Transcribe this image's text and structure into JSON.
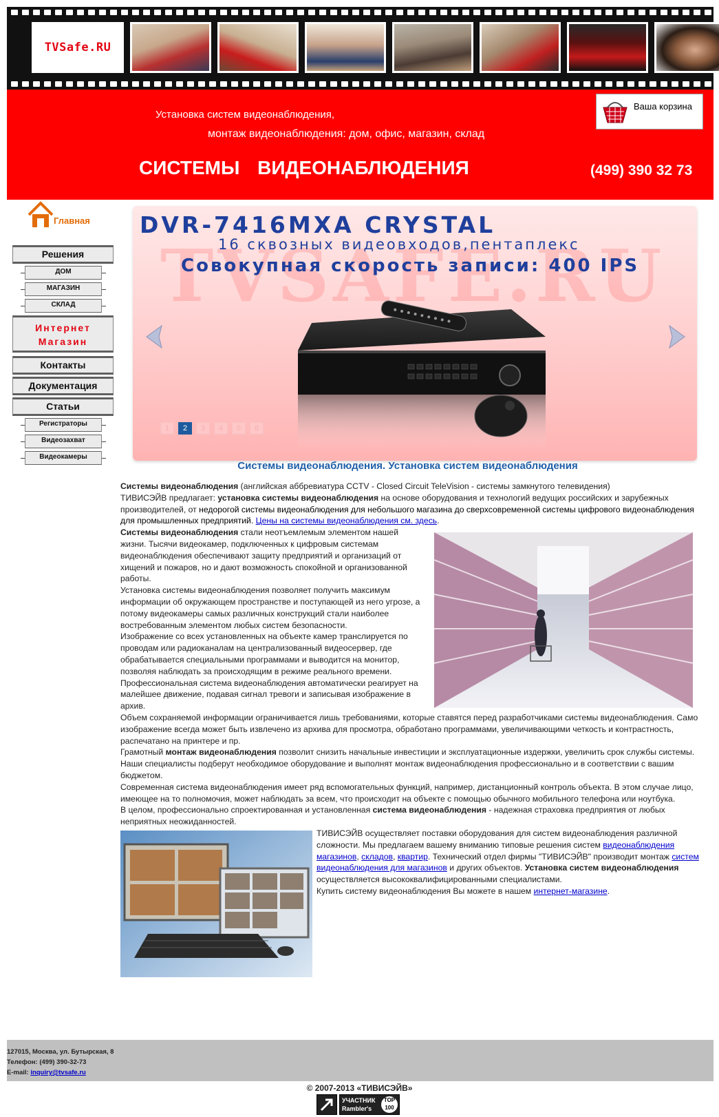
{
  "header": {
    "logo_text": "TVSafe.RU",
    "photo_count": 7
  },
  "banner": {
    "line1": "Установка систем видеонаблюдения,",
    "line2": "монтаж видеонаблюдения: дом, офис, магазин, склад",
    "title": "СИСТЕМЫ ВИДЕОНАБЛЮДЕНИЯ",
    "phone": "(499) 390 32 73",
    "cart_label": "Ваша корзина",
    "bg_color": "#ff0000"
  },
  "nav": {
    "home_label": "Главная",
    "solutions": "Решения",
    "home_item": "ДОМ",
    "shop_item": "МАГАЗИН",
    "warehouse_item": "СКЛАД",
    "online_shop_line1": "Интернет",
    "online_shop_line2": "Магазин",
    "contacts": "Контакты",
    "docs": "Документация",
    "articles": "Статьи",
    "recorders": "Регистраторы",
    "capture": "Видеозахват",
    "cameras": "Видеокамеры"
  },
  "slider": {
    "watermark": "TVSAFE.RU",
    "title": "DVR-7416MXA CRYSTAL",
    "subtitle": "16 сквозных видеовходов,пентаплекс",
    "speed": "Совокупная скорость записи: 400 IPS",
    "pages": [
      "1",
      "2",
      "3",
      "4",
      "5",
      "6"
    ],
    "active_page": "2"
  },
  "main": {
    "heading": "Системы видеонаблюдения. Установка систем видеонаблюдения",
    "p1_bold": "Системы видеонаблюдения",
    "p1_rest": " (английская аббревиатура CCTV - Closed Circuit TeleVision - системы замкнутого телевидения)",
    "p2_a": "ТИВИСЭЙВ предлагает: ",
    "p2_bold": "установка системы видеонаблюдения",
    "p2_b": "  на основе оборудования и технологий ведущих российских и зарубежных производителей, от ",
    "p2_dark": "недорогой системы видеонаблюдения для небольшого магазина до сверхсовременной системы цифрового видеонаблюдения для промышленных предприятий",
    "p2_c": ". ",
    "p2_link": "Цены на системы видеонаблюдения см. здесь",
    "p2_d": ".",
    "p3_bold": "Системы видеонаблюдения",
    "p3_rest": " стали неотъемлемым элементом нашей жизни. Тысячи видеокамер, подключенных к цифровым системам видеонаблюдения обеспечивают защиту предприятий и организаций от хищений и пожаров, но и дают возможность спокойной и организованной работы.",
    "p4": "Установка системы видеонаблюдения позволяет получить максимум информации об окружающем пространстве и поступающей из него угрозе, а потому видеокамеры самых различных конструкций стали наиболее востребованным элементом любых систем безопасности.",
    "p5": "Изображение со всех установленных на объекте камер транслируется по проводам или радиоканалам на централизованный видеосервер, где обрабатывается специальными программами и выводится на монитор, позволяя наблюдать за происходящим в режиме реального времени.",
    "p6": "Профессиональная система видеонаблюдения автоматически реагирует на малейшее движение, подавая сигнал тревоги и записывая изображение в архив.",
    "p7": "Объем сохраняемой информации ограничивается лишь требованиями, которые ставятся перед разработчиками системы видеонаблюдения. Само изображение всегда может быть извлечено из архива для просмотра, обработано программами, увеличивающими четкость и контрастность, распечатано на принтере и пр.",
    "p8_a": "Грамотный ",
    "p8_bold": "монтаж видеонаблюдения",
    "p8_b": " позволит снизить начальные инвестиции и эксплуатационные издержки, увеличить срок службы системы. Наши специалисты подберут необходимое оборудование и выполнят монтаж видеонаблюдения профессионально и в соответствии с вашим бюджетом.",
    "p9": "Современная система видеонаблюдения имеет ряд вспомогательных функций, например, дистанционный контроль объекта. В этом случае лицо, имеющее на то полномочия, может наблюдать за всем, что происходит на объекте с помощью обычного мобильного телефона или ноутбука.",
    "p10_a": "В целом, профессионально спроектированная и установленная ",
    "p10_bold": "система видеонаблюдения",
    "p10_b": " - надежная  страховка предприятия от любых неприятных неожиданностей.",
    "p11_a": "ТИВИСЭЙВ осуществляет поставки оборудования для систем видеонаблюдения различной сложности. Мы предлагаем вашему вниманию типовые решения  систем ",
    "p11_link1": "видеонаблюдения магазинов",
    "p11_comma1": ", ",
    "p11_link2": "складов",
    "p11_comma2": ", ",
    "p11_link3": "квартир",
    "p11_b": ". Технический отдел фирмы \"ТИВИСЭЙВ\" производит монтаж ",
    "p11_link4": "систем видеонаблюдения для магазинов",
    "p11_c": " и других объектов. ",
    "p11_bold": "Установка систем видеонаблюдения",
    "p11_d": " осуществляется высококвалифицированными специалистами.",
    "p12_a": "Купить систему видеонаблюдения Вы можете в нашем ",
    "p12_link": "интернет-магазине",
    "p12_b": "."
  },
  "footer": {
    "address": "127015, Москва, ул. Бутырская, 8",
    "phone": "Телефон: (499) 390-32-73",
    "email_label": "E-mail: ",
    "email": "inquiry@tvsafe.ru",
    "copyright": "© 2007-2013 «ТИВИСЭЙВ»",
    "badge_line1": "УЧАСТНИК",
    "badge_line2": "Rambler's",
    "badge_top": "TOP 100"
  }
}
